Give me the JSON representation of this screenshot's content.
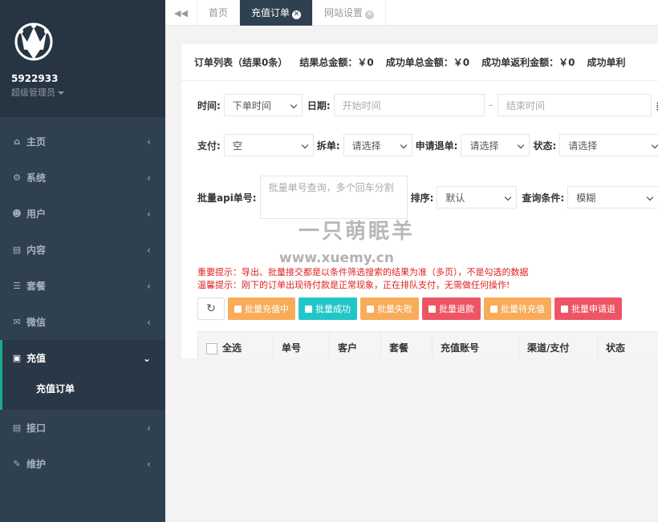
{
  "sidebar": {
    "user_id": "5922933",
    "role": "超级管理员",
    "items": [
      {
        "label": "主页",
        "icon": "home-icon",
        "glyph": "⌂",
        "arrow": "‹"
      },
      {
        "label": "系统",
        "icon": "gears-icon",
        "glyph": "⚙",
        "arrow": "‹"
      },
      {
        "label": "用户",
        "icon": "users-icon",
        "glyph": "☻",
        "arrow": "‹"
      },
      {
        "label": "内容",
        "icon": "file-icon",
        "glyph": "▤",
        "arrow": "‹"
      },
      {
        "label": "套餐",
        "icon": "list-icon",
        "glyph": "☰",
        "arrow": "‹"
      },
      {
        "label": "微信",
        "icon": "wechat-icon",
        "glyph": "✉",
        "arrow": "‹"
      },
      {
        "label": "充值",
        "icon": "document-icon",
        "glyph": "▣",
        "arrow": "⌄"
      },
      {
        "label": "接口",
        "icon": "file-icon",
        "glyph": "▤",
        "arrow": "‹"
      },
      {
        "label": "维护",
        "icon": "wrench-icon",
        "glyph": "✎",
        "arrow": "‹"
      }
    ],
    "submenu": [
      "充值订单"
    ]
  },
  "tabs": {
    "items": [
      {
        "label": "首页"
      },
      {
        "label": "充值订单"
      },
      {
        "label": "网站设置"
      }
    ]
  },
  "summary": {
    "list": "订单列表（结果0条）",
    "total": "结果总金额：￥0",
    "success_total": "成功单总金额：￥0",
    "rebate": "成功单返利金额：￥0",
    "cut": "成功单利"
  },
  "filters": {
    "time_label": "时间:",
    "time_value": "下单时间",
    "date_label": "日期:",
    "start_placeholder": "开始时间",
    "dash": "-",
    "end_placeholder": "结束时间",
    "date_trailing": "类",
    "pay_label": "支付:",
    "pay_value": "空",
    "split_label": "拆单:",
    "split_value": "请选择",
    "refund_label": "申请退单:",
    "refund_value": "请选择",
    "status_label": "状态:",
    "status_value": "请选择",
    "batch_label": "批量api单号:",
    "batch_placeholder": "批量单号查询，多个回车分割",
    "sort_label": "排序:",
    "sort_value": "默认",
    "query_label": "查询条件:",
    "query_value": "模糊"
  },
  "notices": {
    "important": "重要提示：导出、批量接交都是以条件筛选搜索的结果为准（多页），不是勾选的数据",
    "warm": "温馨提示：刚下的订单出现待付款是正常现象，正在排队支付，无需做任何操作!"
  },
  "buttons": {
    "refresh": "↻",
    "items": [
      "批量充值中",
      "批量成功",
      "批量失败",
      "批量退款",
      "批量待充值",
      "批量申请退"
    ]
  },
  "table": {
    "headers": [
      "全选",
      "单号",
      "客户",
      "套餐",
      "充值账号",
      "渠道/支付",
      "状态"
    ]
  },
  "watermark": {
    "line1": "一只萌眠羊",
    "line2": "www.xuemy.cn"
  }
}
